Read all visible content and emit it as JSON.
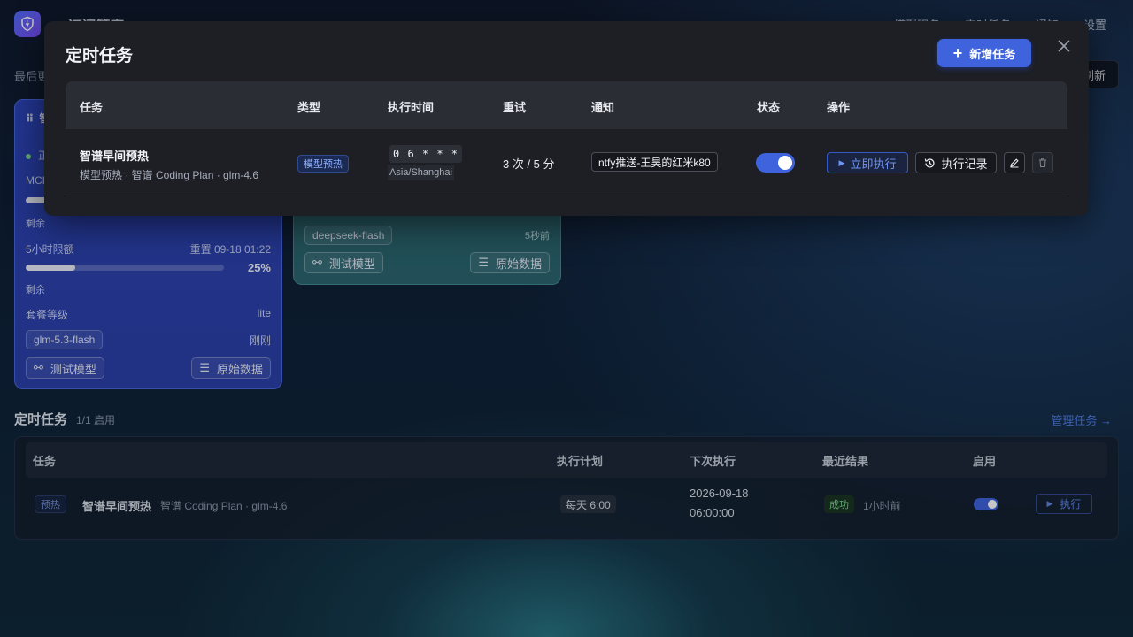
{
  "app": {
    "title": "AI 订阅管家",
    "nav": [
      "模型服务",
      "定时任务",
      "通知",
      "设置"
    ],
    "last_update": "最后更新",
    "refresh": "刷新"
  },
  "card_blue": {
    "title": "智",
    "status": "正",
    "mcp_label": "MCI",
    "remain1": "剩余",
    "limit_label": "5小时限额",
    "reset": "重置 09-18 01:22",
    "percent": "25%",
    "percent_value": 25,
    "remain2": "剩余",
    "plan_label": "套餐等级",
    "plan_value": "lite",
    "model_chip": "glm-5.3-flash",
    "model_time": "刚刚",
    "test_btn": "测试模型",
    "raw_btn": "原始数据"
  },
  "card_teal": {
    "model_chip": "deepseek-flash",
    "time": "5秒前",
    "test_btn": "测试模型",
    "raw_btn": "原始数据"
  },
  "schedule_section": {
    "title": "定时任务",
    "subtitle": "1/1 启用",
    "manage_link": "管理任务 →",
    "headers": [
      "任务",
      "执行计划",
      "下次执行",
      "最近结果",
      "启用"
    ],
    "row": {
      "tag": "预热",
      "name": "智谱早间预热",
      "desc": "智谱 Coding Plan · glm-4.6",
      "plan": "每天 6:00",
      "next_date": "2026-09-18",
      "next_time": "06:00:00",
      "result": "成功",
      "result_time": "1小时前",
      "enabled": true,
      "run_btn": "执行"
    }
  },
  "modal": {
    "title": "定时任务",
    "add_button": "新增任务",
    "headers": {
      "task": "任务",
      "type": "类型",
      "time": "执行时间",
      "retry": "重试",
      "notify": "通知",
      "status": "状态",
      "ops": "操作"
    },
    "row": {
      "name": "智谱早间预热",
      "desc": "模型预热 · 智谱 Coding Plan · glm-4.6",
      "type": "模型预热",
      "cron": "0 6 * * *",
      "timezone": "Asia/Shanghai",
      "retry": "3 次 / 5 分",
      "notify": "ntfy推送-王昊的红米k80",
      "enabled": true,
      "run_now": "立即执行",
      "history": "执行记录"
    }
  },
  "colors": {
    "accent": "#3e63dd",
    "modal_bg": "#1d1f25",
    "success": "#7bd88f"
  }
}
